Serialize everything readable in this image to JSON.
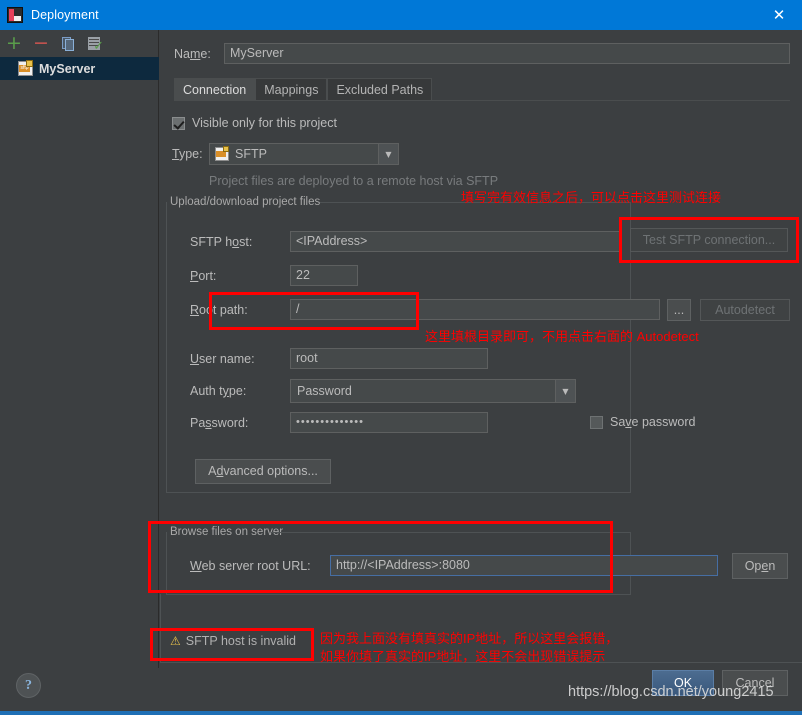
{
  "window": {
    "title": "Deployment",
    "close_label": "✕",
    "app_icon": "intellij-idea-icon"
  },
  "sidebar": {
    "toolbar": [
      {
        "name": "add-button",
        "glyph": "+"
      },
      {
        "name": "remove-button",
        "glyph": "−"
      },
      {
        "name": "copy-button",
        "glyph": "copy"
      },
      {
        "name": "set-default-button",
        "glyph": "check"
      }
    ],
    "servers": [
      {
        "label": "MyServer",
        "selected": true,
        "icon": "sftp-server-icon"
      }
    ]
  },
  "form": {
    "name_label": "Name:",
    "name_value": "MyServer",
    "tabs": [
      {
        "label": "Connection",
        "active": true
      },
      {
        "label": "Mappings",
        "active": false
      },
      {
        "label": "Excluded Paths",
        "active": false
      }
    ],
    "visible_only_label": "Visible only for this project",
    "visible_only_checked": true,
    "type_label": "Type:",
    "type_value": "SFTP",
    "type_hint": "Project files are deployed to a remote host via SFTP",
    "upload_group_title": "Upload/download project files",
    "sftp_host_label": "SFTP host:",
    "sftp_host_value": "<IPAddress>",
    "test_connection_label": "Test SFTP connection...",
    "port_label": "Port:",
    "port_value": "22",
    "root_path_label": "Root path:",
    "root_path_value": "/",
    "browse_button_label": "...",
    "autodetect_label": "Autodetect",
    "user_name_label": "User name:",
    "user_name_value": "root",
    "auth_type_label": "Auth type:",
    "auth_type_value": "Password",
    "password_label": "Password:",
    "password_value": "••••••••••••••",
    "save_password_label": "Save password",
    "save_password_checked": false,
    "advanced_options_label": "Advanced options...",
    "browse_group_title": "Browse files on server",
    "web_root_label": "Web server root URL:",
    "web_root_value": "http://<IPAddress>:8080",
    "open_label": "Open"
  },
  "error": {
    "icon": "warning-icon",
    "message": "SFTP host is invalid"
  },
  "footer": {
    "help_label": "?",
    "ok_label": "OK",
    "cancel_label": "Cancel"
  },
  "annotations": [
    {
      "name": "annotation-test-connection",
      "text": "填写完有效信息之后，可以点击这里测试连接"
    },
    {
      "name": "annotation-root-path",
      "text": "这里填根目录即可，不用点击右面的 Autodetect"
    },
    {
      "name": "annotation-error-line1",
      "text": "因为我上面没有填真实的IP地址，所以这里会报错，"
    },
    {
      "name": "annotation-error-line2",
      "text": "如果你填了真实的IP地址，这里不会出现错误提示"
    }
  ],
  "watermark": {
    "text": "https://blog.csdn.net/young2415"
  },
  "colors": {
    "accent": "#0078d7",
    "background": "#3c3f41",
    "field": "#45494a",
    "annotation": "#ff0000",
    "selection": "#0d293e",
    "ok_button": "#4c6c90"
  }
}
